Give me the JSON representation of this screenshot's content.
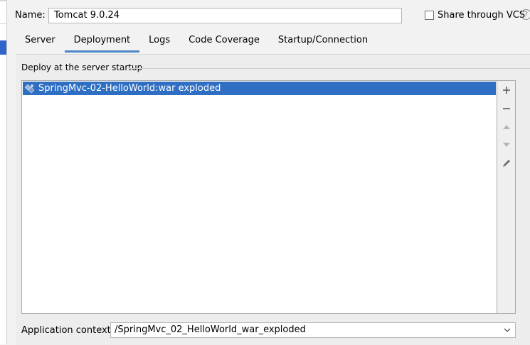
{
  "header": {
    "name_label": "Name:",
    "name_value": "Tomcat 9.0.24",
    "share_label": "Share through VCS",
    "share_checked": false,
    "help_symbol": "?"
  },
  "tabs": [
    {
      "label": "Server",
      "selected": false
    },
    {
      "label": "Deployment",
      "selected": true
    },
    {
      "label": "Logs",
      "selected": false
    },
    {
      "label": "Code Coverage",
      "selected": false
    },
    {
      "label": "Startup/Connection",
      "selected": false
    }
  ],
  "deployment": {
    "group_title": "Deploy at the server startup",
    "items": [
      {
        "label": "SpringMvc-02-HelloWorld:war exploded",
        "icon": "war-exploded-artifact-icon",
        "selected": true
      }
    ],
    "toolbar": [
      "add-icon",
      "remove-icon",
      "move-up-icon",
      "move-down-icon",
      "edit-pencil-icon"
    ],
    "context_label": "Application context:",
    "context_value": "/SpringMvc_02_HelloWorld_war_exploded"
  },
  "colors": {
    "selection": "#2f6fc3",
    "tab_underline": "#4a86c7",
    "sidebar_selection": "#2f65ca"
  }
}
